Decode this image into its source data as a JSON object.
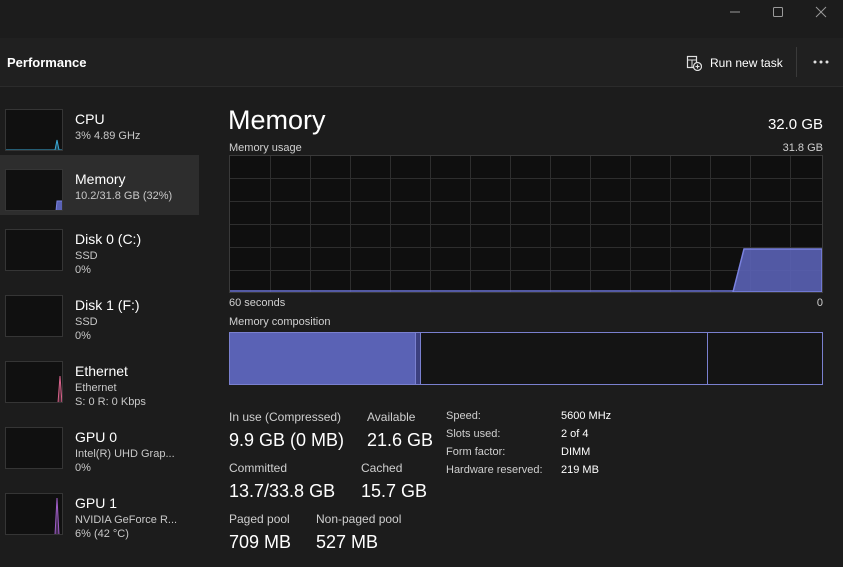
{
  "header": {
    "title": "Performance",
    "run_new_task": "Run new task",
    "icons": {
      "run_task": "new-task-icon",
      "more": "more-options-icon"
    }
  },
  "window_controls": {
    "minimize": "minimize-icon",
    "maximize": "maximize-icon",
    "close": "close-icon"
  },
  "sidebar": {
    "items": [
      {
        "name": "CPU",
        "line1": "3%  4.89 GHz",
        "line2": "",
        "active": false,
        "graph_color": "#3aaad8",
        "load_percent": 3
      },
      {
        "name": "Memory",
        "line1": "10.2/31.8 GB (32%)",
        "line2": "",
        "active": true,
        "graph_color": "#6b73d6",
        "load_percent": 32
      },
      {
        "name": "Disk 0 (C:)",
        "line1": "SSD",
        "line2": "0%",
        "active": false,
        "graph_color": "#4aa84a",
        "load_percent": 0
      },
      {
        "name": "Disk 1 (F:)",
        "line1": "SSD",
        "line2": "0%",
        "active": false,
        "graph_color": "#4aa84a",
        "load_percent": 0
      },
      {
        "name": "Ethernet",
        "line1": "Ethernet",
        "line2": "S: 0  R: 0 Kbps",
        "active": false,
        "graph_color": "#d9638c",
        "load_percent": 0
      },
      {
        "name": "GPU 0",
        "line1": "Intel(R) UHD Grap...",
        "line2": "0%",
        "active": false,
        "graph_color": "#a05ec8",
        "load_percent": 0
      },
      {
        "name": "GPU 1",
        "line1": "NVIDIA GeForce R...",
        "line2": "6%  (42 °C)",
        "active": false,
        "graph_color": "#a05ec8",
        "load_percent": 6
      }
    ]
  },
  "main": {
    "title": "Memory",
    "total": "32.0 GB",
    "usage_label": "Memory usage",
    "usage_max": "31.8 GB",
    "axis_left": "60 seconds",
    "axis_right": "0",
    "composition_label": "Memory composition",
    "usage_fraction": 0.32,
    "composition": {
      "in_use_fraction": 0.31,
      "modified_fraction": 0.01,
      "standby_fraction": 0.49,
      "free_fraction": 0.19
    },
    "stats": {
      "in_use_label": "In use (Compressed)",
      "in_use_value": "9.9 GB (0 MB)",
      "available_label": "Available",
      "available_value": "21.6 GB",
      "committed_label": "Committed",
      "committed_value": "13.7/33.8 GB",
      "cached_label": "Cached",
      "cached_value": "15.7 GB",
      "paged_label": "Paged pool",
      "paged_value": "709 MB",
      "nonpaged_label": "Non-paged pool",
      "nonpaged_value": "527 MB"
    },
    "specs": {
      "speed_label": "Speed:",
      "speed_value": "5600 MHz",
      "slots_label": "Slots used:",
      "slots_value": "2 of 4",
      "form_label": "Form factor:",
      "form_value": "DIMM",
      "reserved_label": "Hardware reserved:",
      "reserved_value": "219 MB"
    }
  },
  "colors": {
    "memory_accent": "#6b73d6",
    "memory_fill": "#5a62b5",
    "background": "#1c1c1c"
  }
}
